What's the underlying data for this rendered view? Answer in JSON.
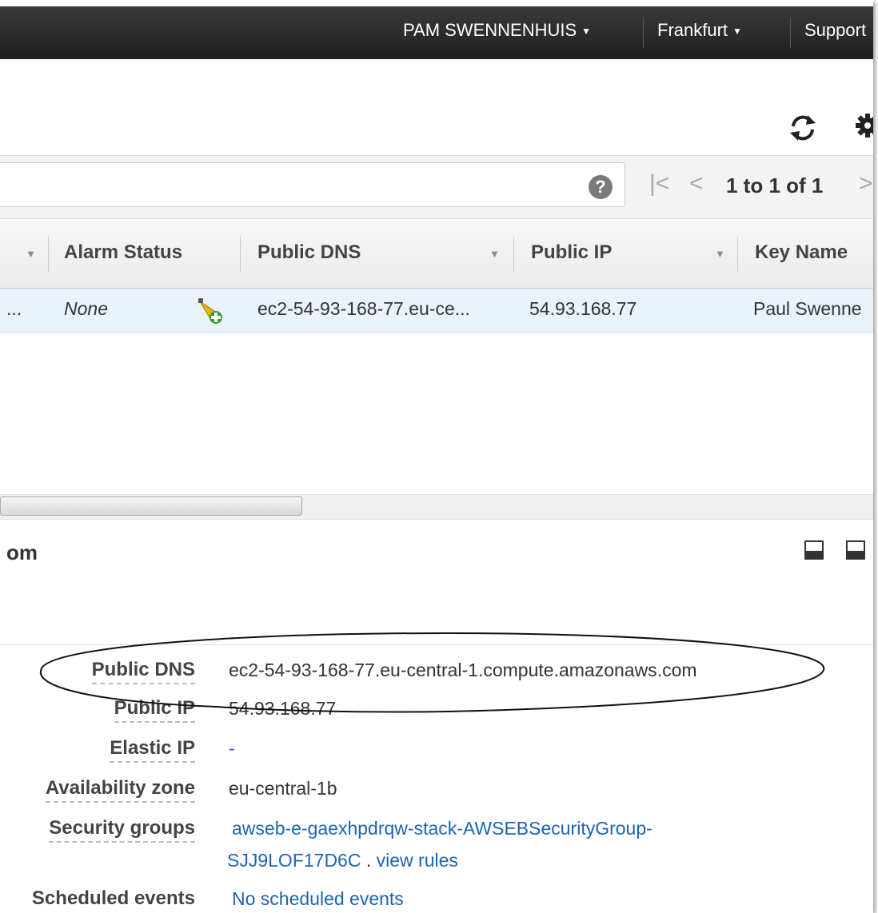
{
  "topbar": {
    "user": "PAM SWENNENHUIS",
    "region": "Frankfurt",
    "support": "Support"
  },
  "filter": {
    "search_value": "",
    "pagination": "1 to 1 of 1"
  },
  "table": {
    "columns": [
      "Alarm Status",
      "Public DNS",
      "Public IP",
      "Key Name"
    ],
    "row": {
      "truncated_prefix": "...",
      "alarm_status": "None",
      "public_dns": "ec2-54-93-168-77.eu-ce...",
      "public_ip": "54.93.168.77",
      "key_name": "Paul Swenne"
    }
  },
  "details": {
    "title": "om",
    "fields": [
      {
        "label": "Public DNS",
        "value": "ec2-54-93-168-77.eu-central-1.compute.amazonaws.com"
      },
      {
        "label": "Public IP",
        "value": "54.93.168.77"
      },
      {
        "label": "Elastic IP",
        "value": "-"
      },
      {
        "label": "Availability zone",
        "value": "eu-central-1b"
      },
      {
        "label": "Security groups",
        "value": "awseb-e-gaexhpdrqw-stack-AWSEBSecurityGroup-",
        "value_line2": "SJJ9LOF17D6C",
        "extra_link": "view rules"
      },
      {
        "label": "Scheduled events",
        "value": "No scheduled events"
      }
    ]
  },
  "colors": {
    "link": "#1f63b3",
    "selected_row": "#eaf3fc",
    "topbar": "#2a2a2a"
  }
}
